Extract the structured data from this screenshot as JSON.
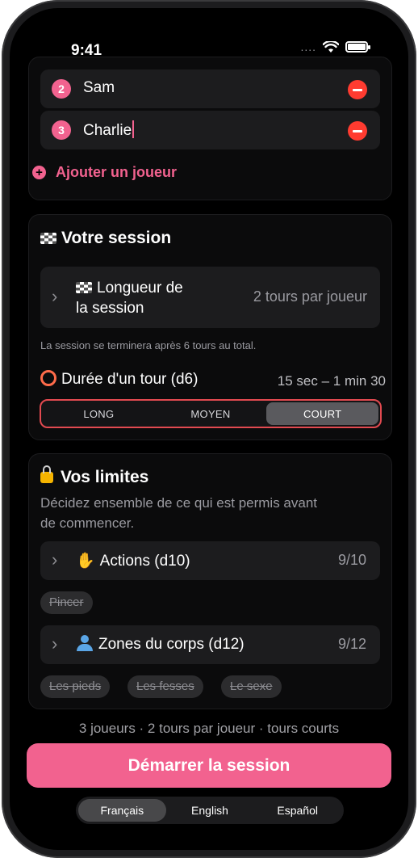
{
  "status_bar": {
    "time": "9:41",
    "signal": "....",
    "wifi_icon": "wifi-icon",
    "battery_icon": "battery-icon"
  },
  "players": {
    "items": [
      {
        "number": "2",
        "name": "Sam"
      },
      {
        "number": "3",
        "name": "Charlie"
      }
    ],
    "add_label": "Ajouter un joueur"
  },
  "session": {
    "title": "Votre session",
    "length_label_line1": "Longueur de",
    "length_label_line2": "la session",
    "length_value": "2 tours par joueur",
    "note": "La session se terminera après 6 tours au total.",
    "turn_label": "Durée d'un tour (d6)",
    "turn_range": "15 sec – 1 min 30",
    "segments": [
      "LONG",
      "MOYEN",
      "COURT"
    ],
    "selected_segment": "COURT"
  },
  "limits": {
    "title": "Vos limites",
    "description_line1": "Décidez ensemble de ce qui est permis avant",
    "description_line2": "de commencer.",
    "actions": {
      "label": "Actions (d10)",
      "count": "9/10",
      "excluded": [
        "Pincer"
      ]
    },
    "zones": {
      "label": "Zones du corps (d12)",
      "count": "9/12",
      "excluded": [
        "Les pieds",
        "Les fesses",
        "Le sexe"
      ]
    }
  },
  "summary": "3 joueurs · 2 tours par joueur · tours courts",
  "start_button": "Démarrer la session",
  "languages": {
    "items": [
      "Français",
      "English",
      "Español"
    ],
    "selected": "Français"
  },
  "colors": {
    "accent": "#f2628f",
    "danger": "#ff3b30",
    "segment_border": "#e24a50",
    "background": "#000000"
  }
}
